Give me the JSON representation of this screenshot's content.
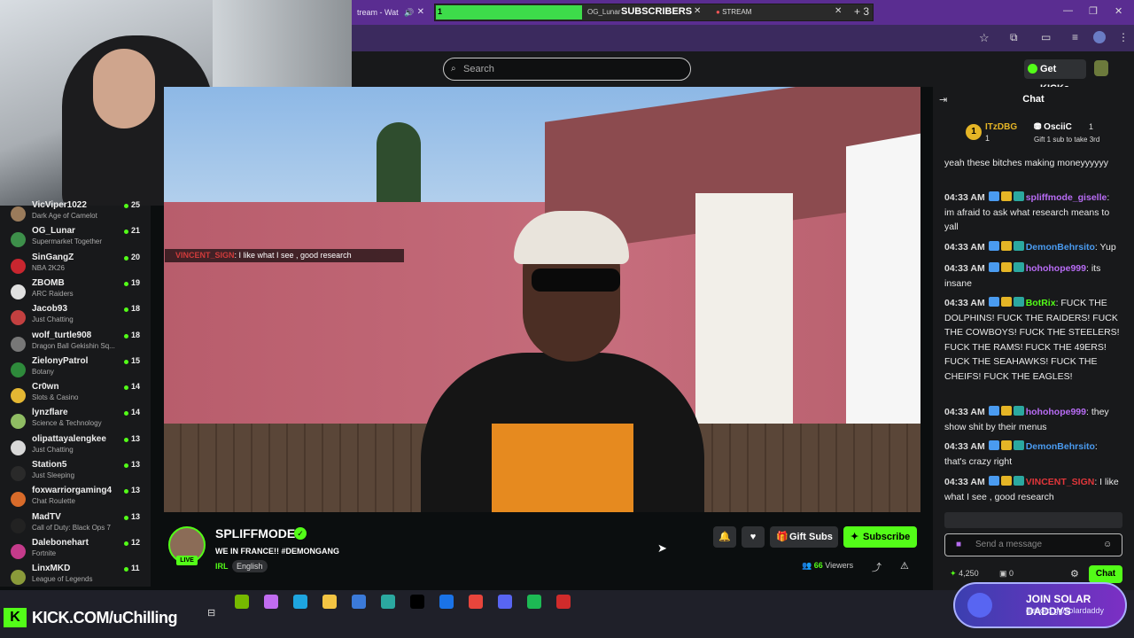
{
  "browser": {
    "tabs": [
      {
        "label": "tream - Wat",
        "icon": "speaker-icon"
      },
      {
        "label": "OG_Lunar",
        "icon": "kick-icon"
      },
      {
        "label": "STREAM",
        "icon": "stream-icon"
      }
    ],
    "new_tab_count": "3",
    "subscribers_goal": {
      "current": "1",
      "label": "SUBSCRIBERS",
      "progress": 0.33
    }
  },
  "header": {
    "search_placeholder": "Search",
    "get_kicks_label": "Get KICKs"
  },
  "sidebar": {
    "channels": [
      {
        "name": "VicViper1022",
        "category": "Dark Age of Camelot",
        "viewers": "25",
        "avatar_color": "#9a7b5b"
      },
      {
        "name": "OG_Lunar",
        "category": "Supermarket Together",
        "viewers": "21",
        "avatar_color": "#3d8f4a"
      },
      {
        "name": "SinGangZ",
        "category": "NBA 2K26",
        "viewers": "20",
        "avatar_color": "#c8262f"
      },
      {
        "name": "ZBOMB",
        "category": "ARC Raiders",
        "viewers": "19",
        "avatar_color": "#e0e0e0"
      },
      {
        "name": "Jacob93",
        "category": "Just Chatting",
        "viewers": "18",
        "avatar_color": "#c34040"
      },
      {
        "name": "wolf_turtle908",
        "category": "Dragon Ball Gekishin Sq...",
        "viewers": "18",
        "avatar_color": "#777"
      },
      {
        "name": "ZielonyPatrol",
        "category": "Botany",
        "viewers": "15",
        "avatar_color": "#2e8a3b"
      },
      {
        "name": "Cr0wn",
        "category": "Slots & Casino",
        "viewers": "14",
        "avatar_color": "#e4b733"
      },
      {
        "name": "lynzflare",
        "category": "Science & Technology",
        "viewers": "14",
        "avatar_color": "#8fbc63"
      },
      {
        "name": "olipattayalengkee",
        "category": "Just Chatting",
        "viewers": "13",
        "avatar_color": "#d8d8d8"
      },
      {
        "name": "Station5",
        "category": "Just Sleeping",
        "viewers": "13",
        "avatar_color": "#2a2a2a"
      },
      {
        "name": "foxwarriorgaming4",
        "category": "Chat Roulette",
        "viewers": "13",
        "avatar_color": "#d86b2a"
      },
      {
        "name": "MadTV",
        "category": "Call of Duty: Black Ops 7",
        "viewers": "13",
        "avatar_color": "#222"
      },
      {
        "name": "Dalebonehart",
        "category": "Fortnite",
        "viewers": "12",
        "avatar_color": "#c43b8b"
      },
      {
        "name": "LinxMKD",
        "category": "League of Legends",
        "viewers": "11",
        "avatar_color": "#8a9a3a"
      }
    ]
  },
  "video_overlay_chat": {
    "user": "VINCENT_SIGN",
    "text": ": I like what I see , good research"
  },
  "stream": {
    "streamer": "SPLIFFMODE",
    "live_label": "LIVE",
    "title": "WE IN FRANCE!! #DEMONGANG",
    "category": "IRL",
    "language": "English",
    "viewers": "66",
    "viewers_label": "Viewers",
    "gift_subs_label": "Gift Subs",
    "subscribe_label": "Subscribe"
  },
  "chat": {
    "title": "Chat",
    "pinned": {
      "rank": "1",
      "user1": "ITzDBG",
      "user1_count": "1",
      "user2": "OsciiC",
      "user2_count": "1",
      "note": "Gift 1 sub to take 3rd"
    },
    "messages": [
      {
        "time": "",
        "user": "",
        "user_color": "#eaeaea",
        "text": "yeah these bitches making moneyyyyyy"
      },
      {
        "time": "04:33 AM",
        "user": "spliffmode_giselle",
        "user_color": "#b86cf5",
        "text": ": im afraid to ask what research means to yall"
      },
      {
        "time": "04:33 AM",
        "user": "DemonBehrsito",
        "user_color": "#4a9bf0",
        "text": ": Yup"
      },
      {
        "time": "04:33 AM",
        "user": "hohohope999",
        "user_color": "#b86cf5",
        "text": ": its insane"
      },
      {
        "time": "04:33 AM",
        "user": "BotRix",
        "user_color": "#53fc18",
        "text": ": FUCK THE DOLPHINS! FUCK THE RAIDERS! FUCK THE COWBOYS! FUCK THE STEELERS! FUCK THE RAMS! FUCK THE 49ERS! FUCK THE SEAHAWKS! FUCK THE CHEIFS! FUCK THE EAGLES!"
      },
      {
        "time": "04:33 AM",
        "user": "hohohope999",
        "user_color": "#b86cf5",
        "text": ": they show shit by their menus"
      },
      {
        "time": "04:33 AM",
        "user": "DemonBehrsito",
        "user_color": "#4a9bf0",
        "text": ": that's crazy right"
      },
      {
        "time": "04:33 AM",
        "user": "VINCENT_SIGN",
        "user_color": "#e0363a",
        "text": ": I like what I see , good research"
      }
    ],
    "input_placeholder": "Send a message",
    "kicks_count": "4,250",
    "gift_count": "0",
    "send_label": "Chat"
  },
  "taskbar": {
    "brand_letter": "K",
    "channel_url": "KICK.COM/uChilling",
    "apps": [
      {
        "name": "nvidia-icon",
        "color": "#76b900"
      },
      {
        "name": "copilot-icon",
        "color": "#c06cf0"
      },
      {
        "name": "edge-icon",
        "color": "#1ea5e0"
      },
      {
        "name": "explorer-icon",
        "color": "#f3c443"
      },
      {
        "name": "calculator-icon",
        "color": "#3b7ad9"
      },
      {
        "name": "gallery-icon",
        "color": "#2ba8a0"
      },
      {
        "name": "tiktok-icon",
        "color": "#000000"
      },
      {
        "name": "outlook-icon",
        "color": "#1a73e8"
      },
      {
        "name": "chrome-icon",
        "color": "#e8453c"
      },
      {
        "name": "discord-icon",
        "color": "#5865f2"
      },
      {
        "name": "spotify-icon",
        "color": "#1db954"
      },
      {
        "name": "app-red-icon",
        "color": "#d02b2b"
      }
    ],
    "banner_title": "JOIN SOLAR DADDYS",
    "banner_sub": "discord.gg/solardaddy"
  }
}
